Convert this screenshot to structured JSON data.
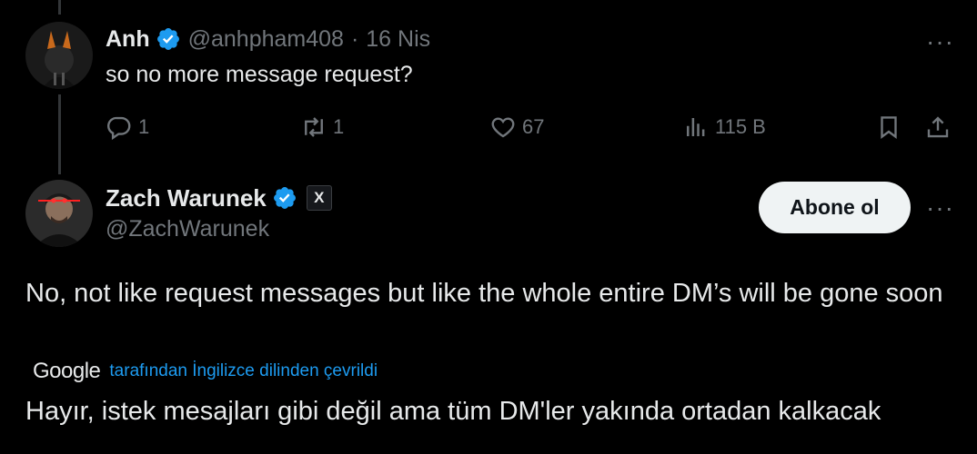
{
  "colors": {
    "background": "#000000",
    "text": "#e7e9ea",
    "muted": "#71767b",
    "link": "#1d9bf0",
    "verified": "#1d9bf0",
    "follow_bg": "#eff3f4"
  },
  "reply": {
    "author_name": "Anh",
    "handle": "@anhpham408",
    "separator": "·",
    "date": "16 Nis",
    "text": "so no more message request?",
    "more_label": "···",
    "actions": {
      "reply_icon": "reply-icon",
      "reply_count": "1",
      "repost_icon": "repost-icon",
      "repost_count": "1",
      "like_icon": "heart-icon",
      "like_count": "67",
      "views_icon": "views-icon",
      "views_count": "115 B",
      "bookmark_icon": "bookmark-icon",
      "share_icon": "share-icon"
    }
  },
  "tweet": {
    "author_name": "Zach Warunek",
    "x_badge": "X",
    "handle": "@ZachWarunek",
    "follow_label": "Abone ol",
    "more_label": "···",
    "text": "No, not like request messages but like the whole entire DM’s will be gone soon",
    "translation": {
      "provider": "Google",
      "label": "tarafından İngilizce dilinden çevrildi",
      "text": "Hayır, istek mesajları gibi değil ama tüm DM'ler yakında ortadan kalkacak"
    }
  }
}
